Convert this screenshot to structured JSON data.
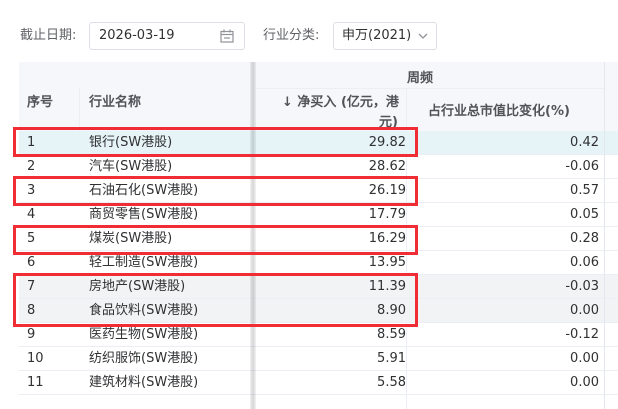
{
  "filter": {
    "date_label": "截止日期:",
    "date_value": "2026-03-19",
    "industry_label": "行业分类:",
    "industry_value": "申万(2021)"
  },
  "table": {
    "group_header": "周频",
    "col_index": "序号",
    "col_name": "行业名称",
    "col_net_buy_line1": "↓ 净买入 (亿元，港",
    "col_net_buy_line2": "元)",
    "col_change": "占行业总市值比变化(%)",
    "rows": [
      {
        "index": "1",
        "name": "银行(SW港股)",
        "net_buy": "29.82",
        "change": "0.42"
      },
      {
        "index": "2",
        "name": "汽车(SW港股)",
        "net_buy": "28.62",
        "change": "-0.06"
      },
      {
        "index": "3",
        "name": "石油石化(SW港股)",
        "net_buy": "26.19",
        "change": "0.57"
      },
      {
        "index": "4",
        "name": "商贸零售(SW港股)",
        "net_buy": "17.79",
        "change": "0.05"
      },
      {
        "index": "5",
        "name": "煤炭(SW港股)",
        "net_buy": "16.29",
        "change": "0.28"
      },
      {
        "index": "6",
        "name": "轻工制造(SW港股)",
        "net_buy": "13.95",
        "change": "0.06"
      },
      {
        "index": "7",
        "name": "房地产(SW港股)",
        "net_buy": "11.39",
        "change": "-0.03"
      },
      {
        "index": "8",
        "name": "食品饮料(SW港股)",
        "net_buy": "8.90",
        "change": "0.00"
      },
      {
        "index": "9",
        "name": "医药生物(SW港股)",
        "net_buy": "8.59",
        "change": "-0.12"
      },
      {
        "index": "10",
        "name": "纺织服饰(SW港股)",
        "net_buy": "5.91",
        "change": "0.00"
      },
      {
        "index": "11",
        "name": "建筑材料(SW港股)",
        "net_buy": "5.58",
        "change": "0.00"
      }
    ]
  },
  "colors": {
    "highlight_row": "#e6f4f8",
    "annotation_red": "#f02d35"
  }
}
